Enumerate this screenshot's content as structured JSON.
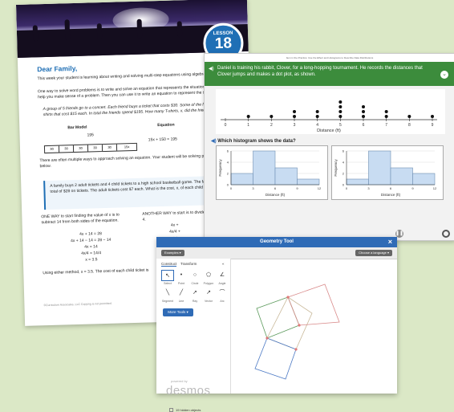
{
  "letter": {
    "lesson_label": "LESSON",
    "lesson_number": "18",
    "greeting": "Dear Family,",
    "intro": "This week your student is learning about writing and solving multi-step equations using algebraic approaches.",
    "para2": "One way to solve word problems is to write and solve an equation that represents the situation. A bar model may help you make sense of a problem. Then you can use it to write an equation to represent the situation.",
    "example": "A group of 5 friends go to a concert. Each friend buys a ticket that costs $30. Some of the friends also buy T-shirts that cost $15 each. In total the friends spend $195. How many T-shirts, x, did the friends buy?",
    "bar_model_heading": "Bar Model",
    "equation_heading": "Equation",
    "bar_total": "195",
    "equation": "15x + 150 = 195",
    "bar_cells": [
      "30",
      "30",
      "30",
      "30",
      "30",
      "15x"
    ],
    "para3": "There are often multiple ways to approach solving an equation. Your student will be solving problems like the one below.",
    "problem": "A family buys 2 adult tickets and 4 child tickets to a high school basketball game. The family spends a total of $28 on tickets. The adult tickets cost $7 each. What is the cost, x, of each child ticket in dollars?",
    "one_way": "ONE WAY to start finding the value of x is to subtract 14 from both sides of the equation.",
    "another_way": "ANOTHER WAY to start is to divide both sides by 4.",
    "steps_left": [
      "4x + 14 = 28",
      "4x + 14 − 14 = 28 − 14",
      "4x = 14",
      "4x/4 = 14/4",
      "x = 3.5"
    ],
    "steps_right": [
      "4x +",
      "4x/4 +",
      "x +",
      "x + 3.5 − 3."
    ],
    "conclusion": "Using either method, x = 3.5. The cost of each child ticket is",
    "footer": "©Curriculum Associates, LLC   Copying is not permitted."
  },
  "app": {
    "top_caption": "Item in the Practice: Use the Effect and Histograms to Describe Data Distributions",
    "prompt": "Daniel is training his rabbit, Clover, for a long-hopping tournament. He records the distances that Clover jumps and makes a dot plot, as shown.",
    "dot_axis_label": "Distance (ft)",
    "dot_ticks": [
      "0",
      "1",
      "2",
      "3",
      "4",
      "5",
      "6",
      "7",
      "8",
      "9"
    ],
    "question": "Which histogram shows the data?",
    "hist_ylabel": "Frequency",
    "hist_xlabel": "Distance (ft)",
    "hist_yticks": [
      "0",
      "2",
      "4",
      "6"
    ],
    "hist_xticks": [
      "0",
      "3",
      "6",
      "9",
      "12"
    ]
  },
  "chart_data": [
    {
      "type": "scatter",
      "title": "",
      "xlabel": "Distance (ft)",
      "ylabel": "",
      "x": [
        1,
        2,
        3,
        3,
        4,
        4,
        5,
        5,
        5,
        5,
        6,
        6,
        6,
        7,
        7,
        8,
        9
      ],
      "y": [
        1,
        1,
        1,
        2,
        1,
        2,
        1,
        2,
        3,
        4,
        1,
        2,
        3,
        1,
        2,
        1,
        1
      ],
      "xlim": [
        0,
        9
      ]
    },
    {
      "type": "bar",
      "title": "",
      "xlabel": "Distance (ft)",
      "ylabel": "Frequency",
      "categories": [
        "0-3",
        "3-6",
        "6-9",
        "9-12"
      ],
      "values": [
        2,
        6,
        3,
        1
      ],
      "ylim": [
        0,
        6
      ]
    },
    {
      "type": "bar",
      "title": "",
      "xlabel": "Distance (ft)",
      "ylabel": "Frequency",
      "categories": [
        "0-3",
        "3-6",
        "6-9",
        "9-12"
      ],
      "values": [
        1,
        6,
        3,
        2
      ],
      "ylim": [
        0,
        6
      ]
    }
  ],
  "geo": {
    "title": "Geometry Tool",
    "close_icon": "×",
    "examples_label": "Examples ▾",
    "language_label": "Choose a language ▾",
    "tab_construct": "Construct",
    "tab_transform": "Transform",
    "collapse_icon": "«",
    "tools": [
      {
        "icon": "↖",
        "label": "Select"
      },
      {
        "icon": "•",
        "label": "Point"
      },
      {
        "icon": "○",
        "label": "Circle"
      },
      {
        "icon": "⬠",
        "label": "Polygon"
      },
      {
        "icon": "∠",
        "label": "Angle"
      },
      {
        "icon": "╲",
        "label": "Segment"
      },
      {
        "icon": "╱",
        "label": "Line"
      },
      {
        "icon": "➚",
        "label": "Ray"
      },
      {
        "icon": "↗",
        "label": "Vector"
      },
      {
        "icon": "⌒",
        "label": "Arc"
      }
    ],
    "more_tools": "More Tools ▾",
    "powered_by": "powered by",
    "brand": "desmos",
    "hidden_objects": "19 hidden objects"
  }
}
